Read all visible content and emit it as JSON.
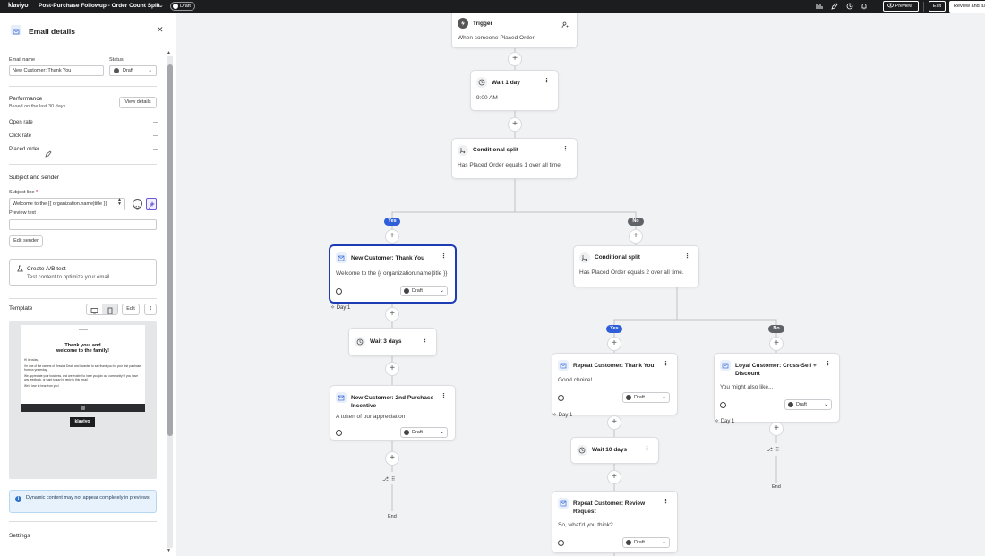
{
  "topbar": {
    "logo": "klaviyo",
    "title": "Post-Purchase Followup - Order Count Split",
    "status": "Draft",
    "preview": "Preview",
    "exit": "Exit",
    "review": "Review and turn on"
  },
  "panel": {
    "header": "Email details",
    "email_name_label": "Email name",
    "email_name_value": "New Customer: Thank You",
    "status_label": "Status",
    "status_value": "Draft",
    "performance_title": "Performance",
    "performance_sub": "Based on the last 30 days",
    "view_details": "View details",
    "metrics": [
      {
        "label": "Open rate",
        "value": "—"
      },
      {
        "label": "Click rate",
        "value": "—"
      },
      {
        "label": "Placed order",
        "value": "—"
      }
    ],
    "subject_title": "Subject and sender",
    "subject_label": "Subject line",
    "subject_required": "*",
    "subject_value": "Welcome to the {{ organization.name|title }}",
    "preview_label": "Preview text",
    "preview_value": "",
    "edit_sender": "Edit sender",
    "ab_title": "Create A/B test",
    "ab_sub": "Test content to optimize your email",
    "template_title": "Template",
    "template_edit": "Edit",
    "thumb": {
      "heading1": "Thank you, and",
      "heading2": "welcome to the family!",
      "greeting": "Hi Iaroslav,",
      "p1": "I'm one of the owners of Ressica Deals and I wanted to say thank you for your first purchase from us yesterday.",
      "p2": "We appreciate your business, and are excited to have you join our community! If you have any feedback, or want to say hi, reply to this email.",
      "p3": "We'd love to hear from you!",
      "logo": "klaviyo"
    },
    "notice": "Dynamic content may not appear completely in previews",
    "settings_title": "Settings"
  },
  "flow": {
    "trigger": {
      "title": "Trigger",
      "sub": "When someone Placed Order"
    },
    "wait1": {
      "title": "Wait 1 day",
      "sub": "9:00 AM"
    },
    "split1": {
      "title": "Conditional split",
      "sub": "Has Placed Order equals 1 over all time."
    },
    "yes_label": "Yes",
    "no_label": "No",
    "email1": {
      "title": "New Customer: Thank You",
      "sub": "Welcome to the {{ organization.name|title }}",
      "status": "Draft",
      "day": "Day 1"
    },
    "wait2": {
      "title": "Wait 3 days"
    },
    "email2": {
      "title": "New Customer: 2nd Purchase Incentive",
      "sub": "A token of our appreciation",
      "status": "Draft"
    },
    "split2": {
      "title": "Conditional split",
      "sub": "Has Placed Order equals 2 over all time."
    },
    "email3": {
      "title": "Repeat Customer: Thank You",
      "sub": "Good choice!",
      "status": "Draft",
      "day": "Day 1"
    },
    "wait3": {
      "title": "Wait 10 days"
    },
    "email4": {
      "title": "Repeat Customer: Review Request",
      "sub": "So, what'd you think?",
      "status": "Draft"
    },
    "email5": {
      "title": "Loyal Customer: Cross-Sell + Discount",
      "sub": "You might also like...",
      "status": "Draft",
      "day": "Day 1"
    },
    "end_label": "End"
  }
}
